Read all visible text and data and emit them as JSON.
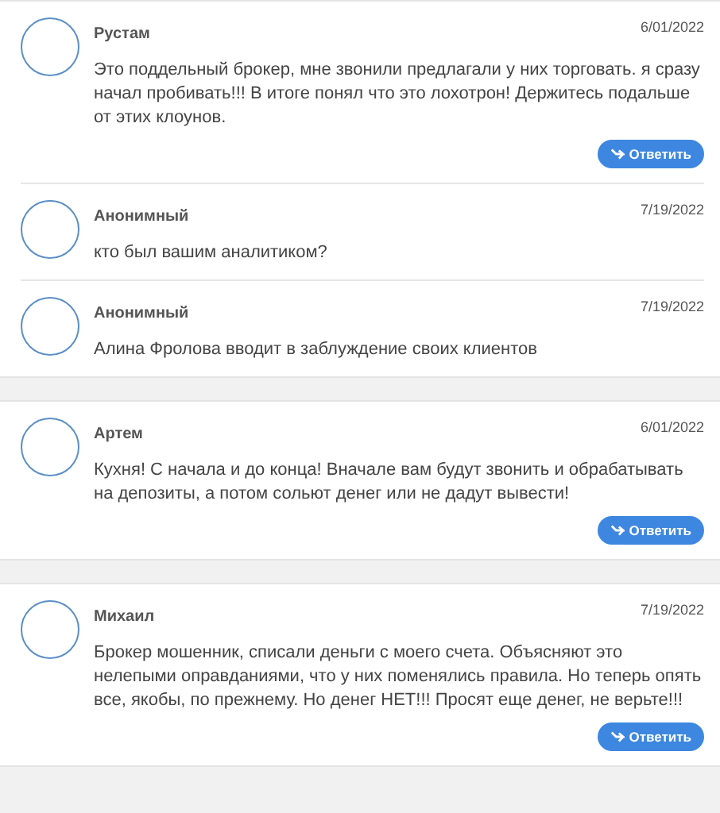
{
  "threads": [
    {
      "comments": [
        {
          "author": "Рустам",
          "date": "6/01/2022",
          "text": "Это поддельный брокер, мне звонили предлагали у них торговать. я сразу начал пробивать!!! В итоге понял что это лохотрон! Держитесь подальше от этих клоунов.",
          "reply_button": "Ответить"
        },
        {
          "author": "Анонимный",
          "date": "7/19/2022",
          "text": "кто был вашим аналитиком?"
        },
        {
          "author": "Анонимный",
          "date": "7/19/2022",
          "text": "Алина Фролова вводит в заблуждение своих клиентов"
        }
      ]
    },
    {
      "comments": [
        {
          "author": "Артем",
          "date": "6/01/2022",
          "text": "Кухня! С начала и до конца! Вначале вам будут звонить и обрабатывать на депозиты, а потом сольют денег или не дадут вывести!",
          "reply_button": "Ответить"
        }
      ]
    },
    {
      "comments": [
        {
          "author": "Михаил",
          "date": "7/19/2022",
          "text": "Брокер мошенник, списали деньги с моего счета. Объясняют это нелепыми оправданиями, что у них поменялись правила. Но теперь опять все, якобы, по прежнему. Но денег НЕТ!!! Просят еще денег, не верьте!!!",
          "reply_button": "Ответить"
        }
      ]
    }
  ]
}
